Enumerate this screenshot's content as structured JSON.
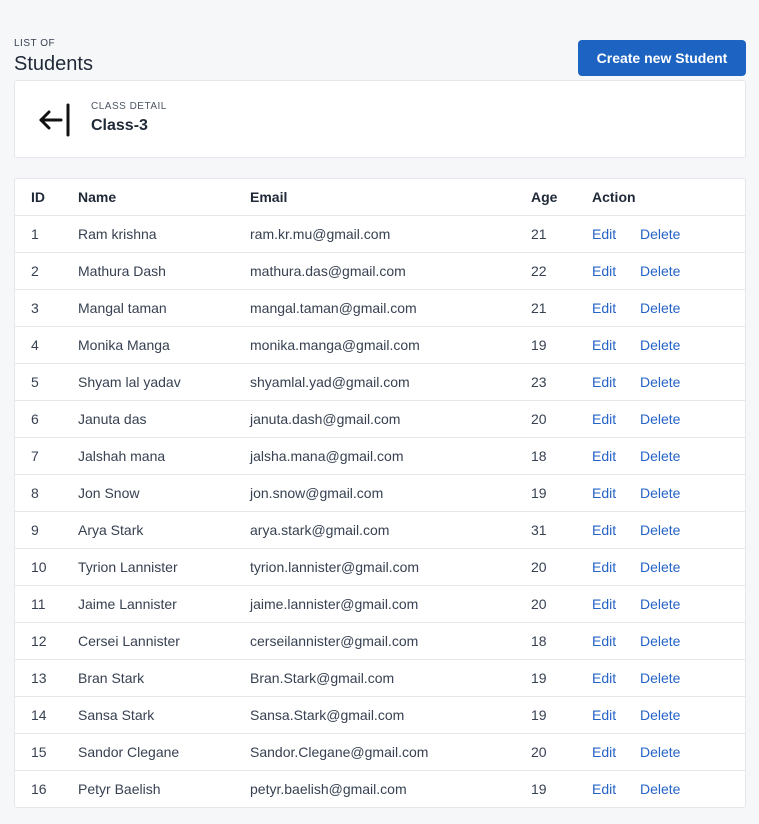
{
  "header": {
    "eyebrow": "LIST OF",
    "title": "Students",
    "create_label": "Create new Student"
  },
  "class_card": {
    "label": "CLASS DETAIL",
    "name": "Class-3",
    "back_icon": "arrow-left-to-line-icon"
  },
  "table": {
    "columns": [
      "ID",
      "Name",
      "Email",
      "Age",
      "Action"
    ],
    "edit_label": "Edit",
    "delete_label": "Delete",
    "rows": [
      {
        "id": "1",
        "name": "Ram krishna",
        "email": "ram.kr.mu@gmail.com",
        "age": "21"
      },
      {
        "id": "2",
        "name": "Mathura Dash",
        "email": "mathura.das@gmail.com",
        "age": "22"
      },
      {
        "id": "3",
        "name": "Mangal taman",
        "email": "mangal.taman@gmail.com",
        "age": "21"
      },
      {
        "id": "4",
        "name": "Monika Manga",
        "email": "monika.manga@gmail.com",
        "age": "19"
      },
      {
        "id": "5",
        "name": "Shyam lal yadav",
        "email": "shyamlal.yad@gmail.com",
        "age": "23"
      },
      {
        "id": "6",
        "name": "Januta das",
        "email": "januta.dash@gmail.com",
        "age": "20"
      },
      {
        "id": "7",
        "name": "Jalshah mana",
        "email": "jalsha.mana@gmail.com",
        "age": "18"
      },
      {
        "id": "8",
        "name": "Jon Snow",
        "email": "jon.snow@gmail.com",
        "age": "19"
      },
      {
        "id": "9",
        "name": "Arya Stark",
        "email": "arya.stark@gmail.com",
        "age": "31"
      },
      {
        "id": "10",
        "name": "Tyrion Lannister",
        "email": "tyrion.lannister@gmail.com",
        "age": "20"
      },
      {
        "id": "11",
        "name": "Jaime Lannister",
        "email": "jaime.lannister@gmail.com",
        "age": "20"
      },
      {
        "id": "12",
        "name": "Cersei Lannister",
        "email": "cerseilannister@gmail.com",
        "age": "18"
      },
      {
        "id": "13",
        "name": "Bran Stark",
        "email": "Bran.Stark@gmail.com",
        "age": "19"
      },
      {
        "id": "14",
        "name": "Sansa Stark",
        "email": "Sansa.Stark@gmail.com",
        "age": "19"
      },
      {
        "id": "15",
        "name": "Sandor Clegane",
        "email": "Sandor.Clegane@gmail.com",
        "age": "20"
      },
      {
        "id": "16",
        "name": "Petyr Baelish",
        "email": "petyr.baelish@gmail.com",
        "age": "19"
      }
    ]
  },
  "colors": {
    "primary": "#1d64c2",
    "link": "#2563c7",
    "background": "#f6f7f9",
    "border": "#e5e7eb"
  }
}
